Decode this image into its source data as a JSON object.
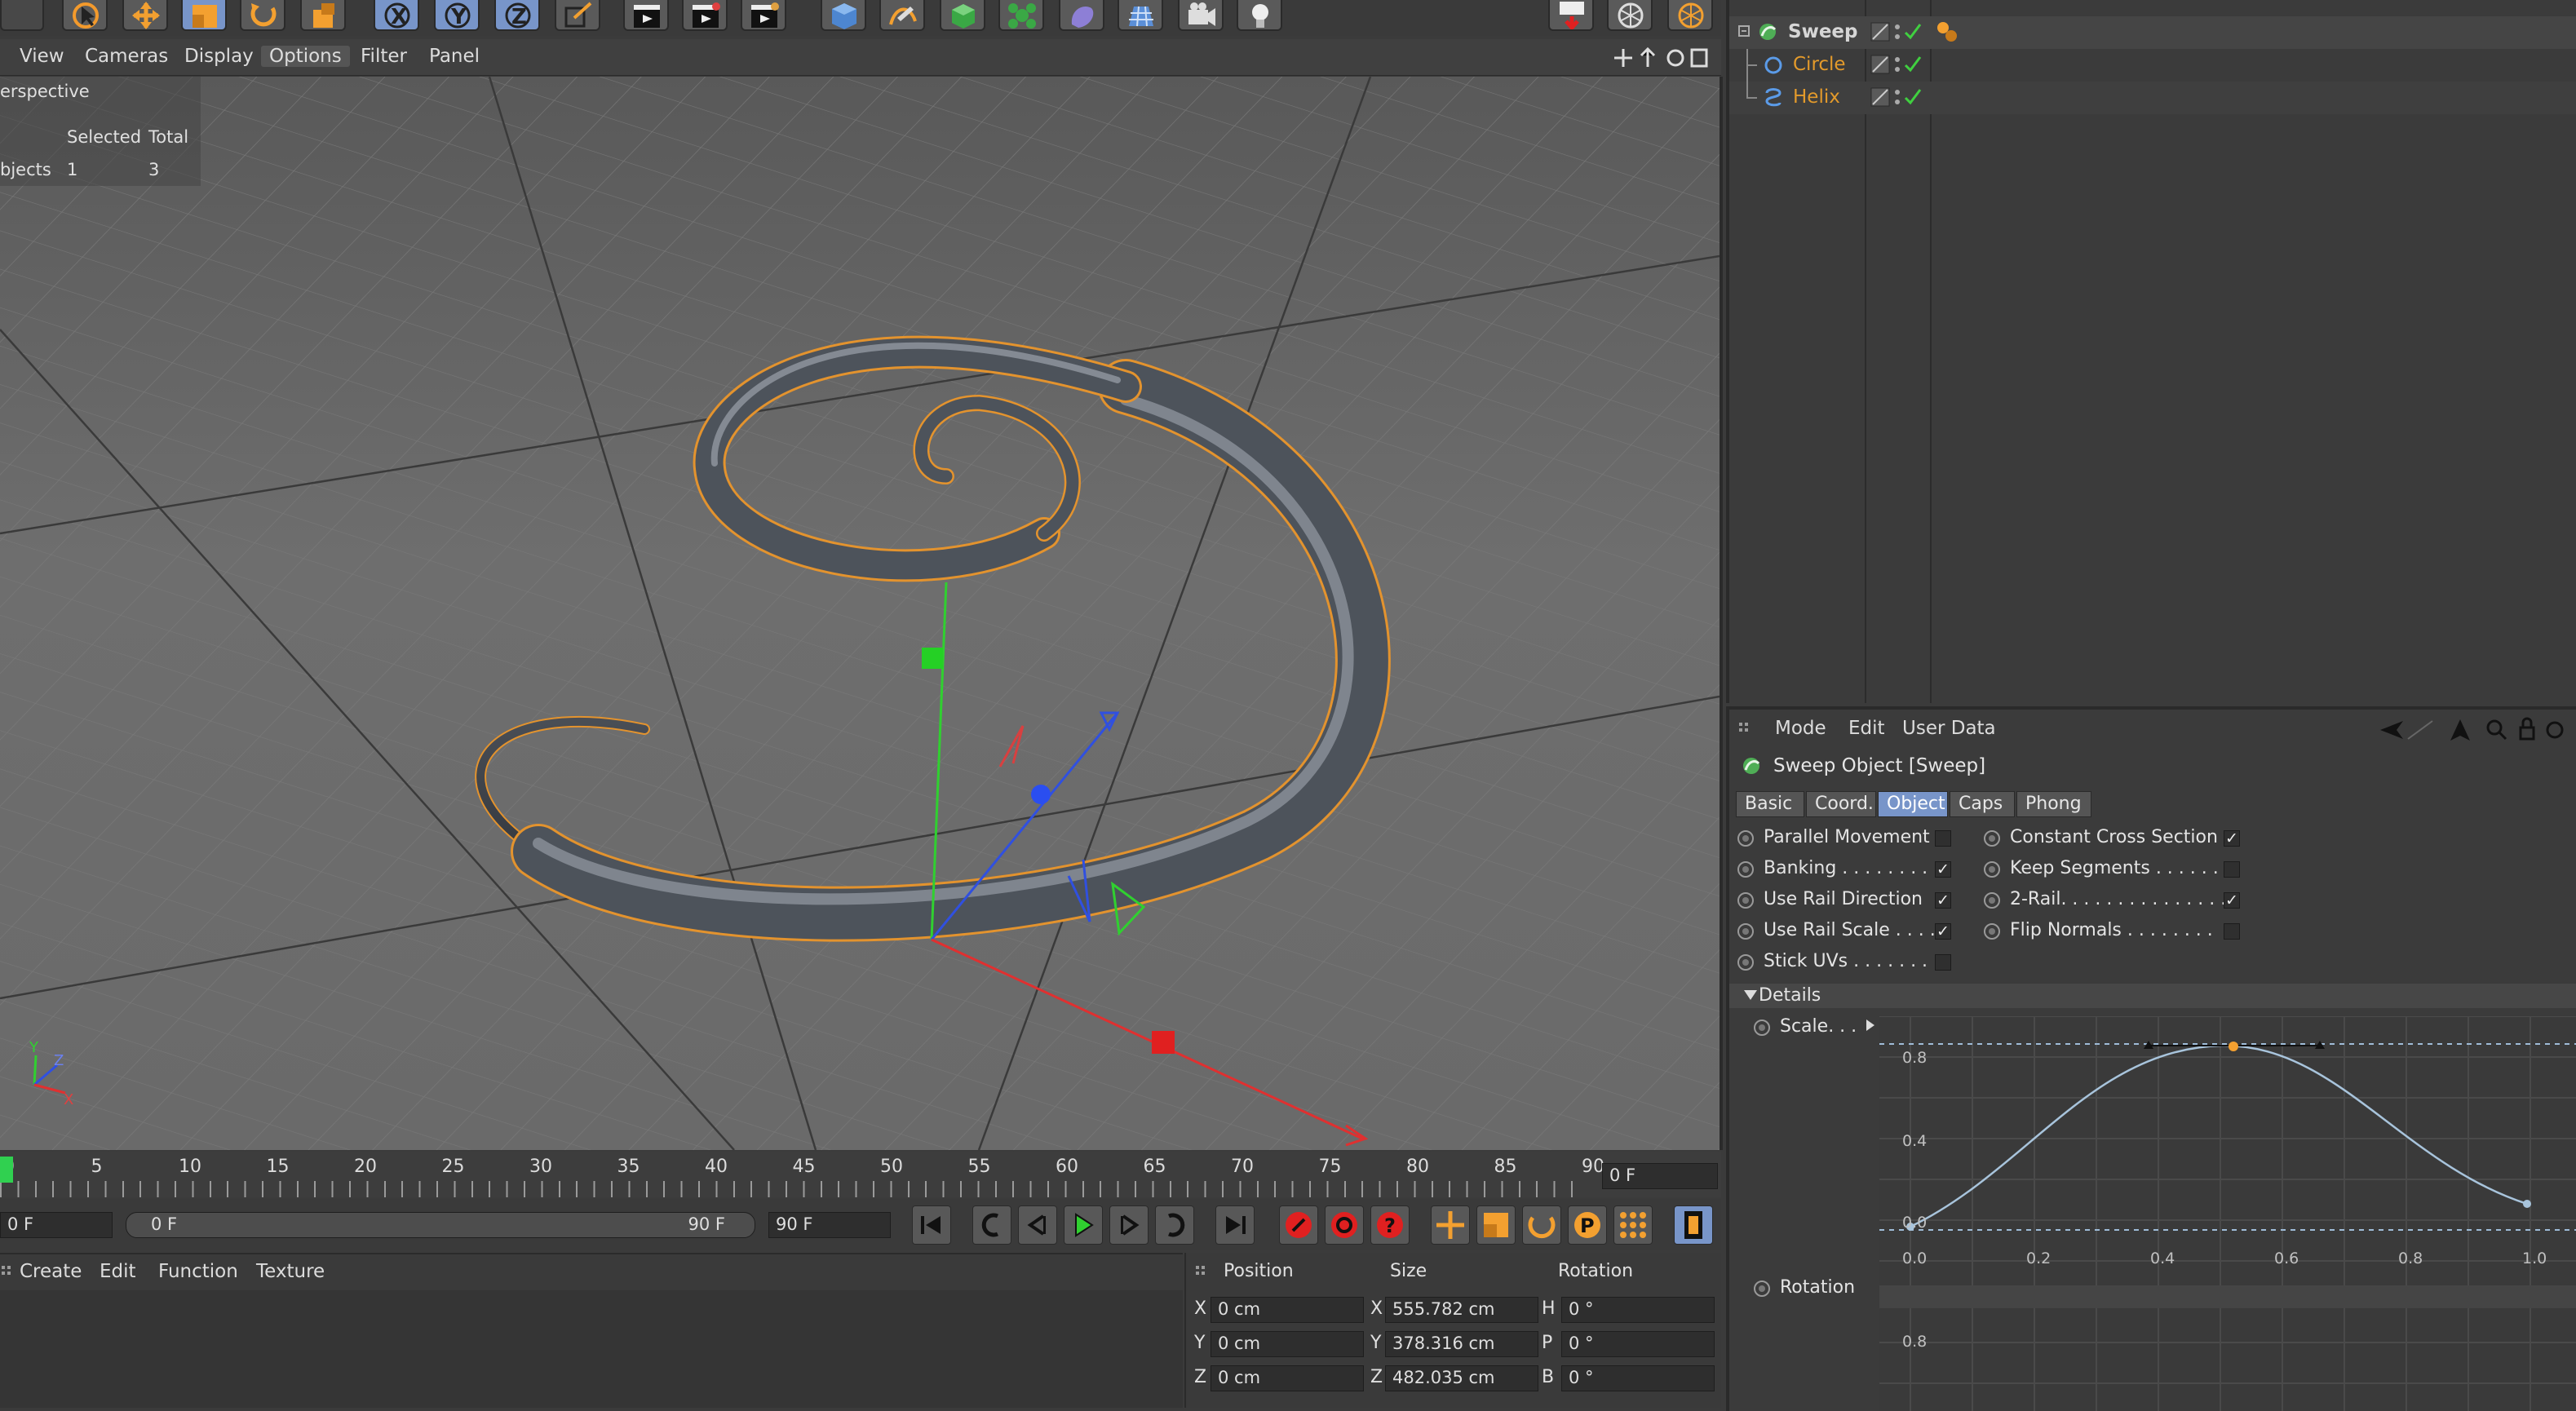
{
  "viewport_menu": [
    "View",
    "Cameras",
    "Display",
    "Options",
    "Filter",
    "Panel"
  ],
  "viewport_active_menu": "Options",
  "viewport_label": "erspective",
  "hud": {
    "col_selected": "Selected",
    "col_total": "Total",
    "row_label": "bjects",
    "selected": "1",
    "total": "3"
  },
  "axis_labels": {
    "x": "X",
    "y": "Y",
    "z": "Z"
  },
  "timeline": {
    "ticks": [
      "0",
      "5",
      "10",
      "15",
      "20",
      "25",
      "30",
      "35",
      "40",
      "45",
      "50",
      "55",
      "60",
      "65",
      "70",
      "75",
      "80",
      "85",
      "90"
    ],
    "current_frame": "0 F",
    "start_field": "0 F",
    "range_start": "0 F",
    "range_end": "90 F",
    "end_field": "90 F"
  },
  "material_menu": [
    "Create",
    "Edit",
    "Function",
    "Texture"
  ],
  "coords": {
    "headers": [
      "Position",
      "Size",
      "Rotation"
    ],
    "rows": [
      {
        "axis": "X",
        "pos": "0 cm",
        "size_axis": "X",
        "size": "555.782 cm",
        "rot_axis": "H",
        "rot": "0 °"
      },
      {
        "axis": "Y",
        "pos": "0 cm",
        "size_axis": "Y",
        "size": "378.316 cm",
        "rot_axis": "P",
        "rot": "0 °"
      },
      {
        "axis": "Z",
        "pos": "0 cm",
        "size_axis": "Z",
        "size": "482.035 cm",
        "rot_axis": "B",
        "rot": "0 °"
      }
    ]
  },
  "objects": [
    {
      "name": "Sweep",
      "color": "#f0b323"
    },
    {
      "name": "Circle",
      "color": "#e39a2b"
    },
    {
      "name": "Helix",
      "color": "#e39a2b"
    }
  ],
  "am": {
    "menu": [
      "Mode",
      "Edit",
      "User Data"
    ],
    "title": "Sweep Object [Sweep]",
    "tabs": [
      "Basic",
      "Coord.",
      "Object",
      "Caps",
      "Phong"
    ],
    "active_tab": "Object",
    "params_left": [
      {
        "label": "Parallel Movement",
        "checked": false
      },
      {
        "label": "Banking . . . . . . . . .",
        "checked": true
      },
      {
        "label": "Use Rail Direction",
        "checked": true
      },
      {
        "label": "Use Rail Scale . . . .",
        "checked": true
      },
      {
        "label": "Stick UVs . . . . . . . .",
        "checked": false
      }
    ],
    "params_right": [
      {
        "label": "Constant Cross Section",
        "checked": true
      },
      {
        "label": "Keep Segments . . . . . .",
        "checked": false
      },
      {
        "label": "2-Rail. . . . . . . . . . . . . . .",
        "checked": true
      },
      {
        "label": "Flip Normals . . . . . . . .",
        "checked": false
      }
    ],
    "details": "Details",
    "scale_label": "Scale. . .",
    "rotation_label": "Rotation",
    "graph_y_labels": [
      "0.8",
      "0.4",
      "0.0"
    ],
    "graph_x_labels": [
      "0.0",
      "0.2",
      "0.4",
      "0.6",
      "0.8",
      "1.0"
    ],
    "graph2_y_label": "0.8"
  },
  "colors": {
    "accent": "#7895c9",
    "selection": "#f0a030",
    "x_axis": "#e03030",
    "y_axis": "#30d030",
    "z_axis": "#3050e0"
  }
}
